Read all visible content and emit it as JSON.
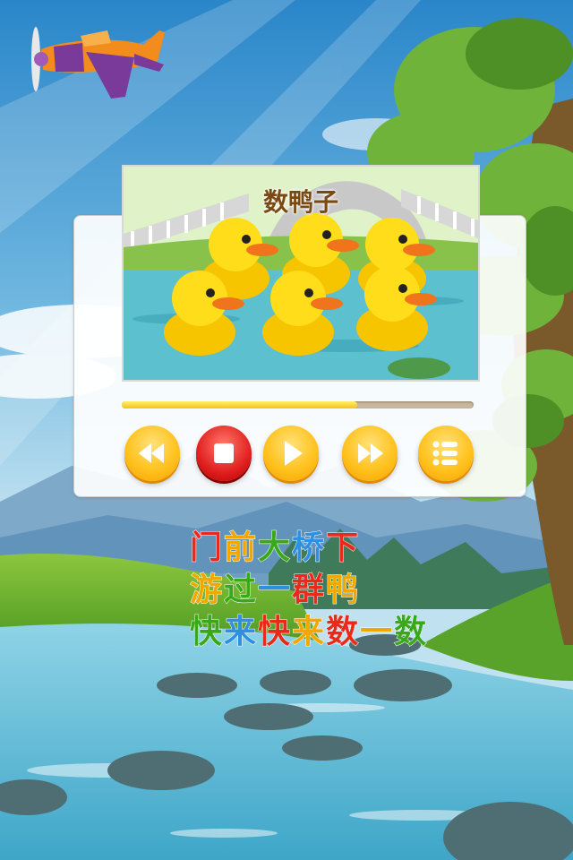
{
  "video": {
    "title": "数鸭子"
  },
  "player": {
    "progress": 0.67,
    "buttons": [
      {
        "name": "rewind-button",
        "icon": "rewind-icon"
      },
      {
        "name": "stop-button",
        "icon": "stop-icon"
      },
      {
        "name": "play-button",
        "icon": "play-icon"
      },
      {
        "name": "fast-forward-button",
        "icon": "fast-forward-icon"
      },
      {
        "name": "playlist-button",
        "icon": "list-icon"
      }
    ]
  },
  "lyrics": {
    "lines": [
      "门前大桥下",
      "游过一群鸭",
      "快来快来数一数"
    ],
    "colors": [
      "#e8291c",
      "#f0a800",
      "#39a81a",
      "#2f8fe0",
      "#e8291c",
      "#f0a800"
    ]
  },
  "colors": {
    "accent": "#ffc21f",
    "stop": "#e11f1f"
  }
}
